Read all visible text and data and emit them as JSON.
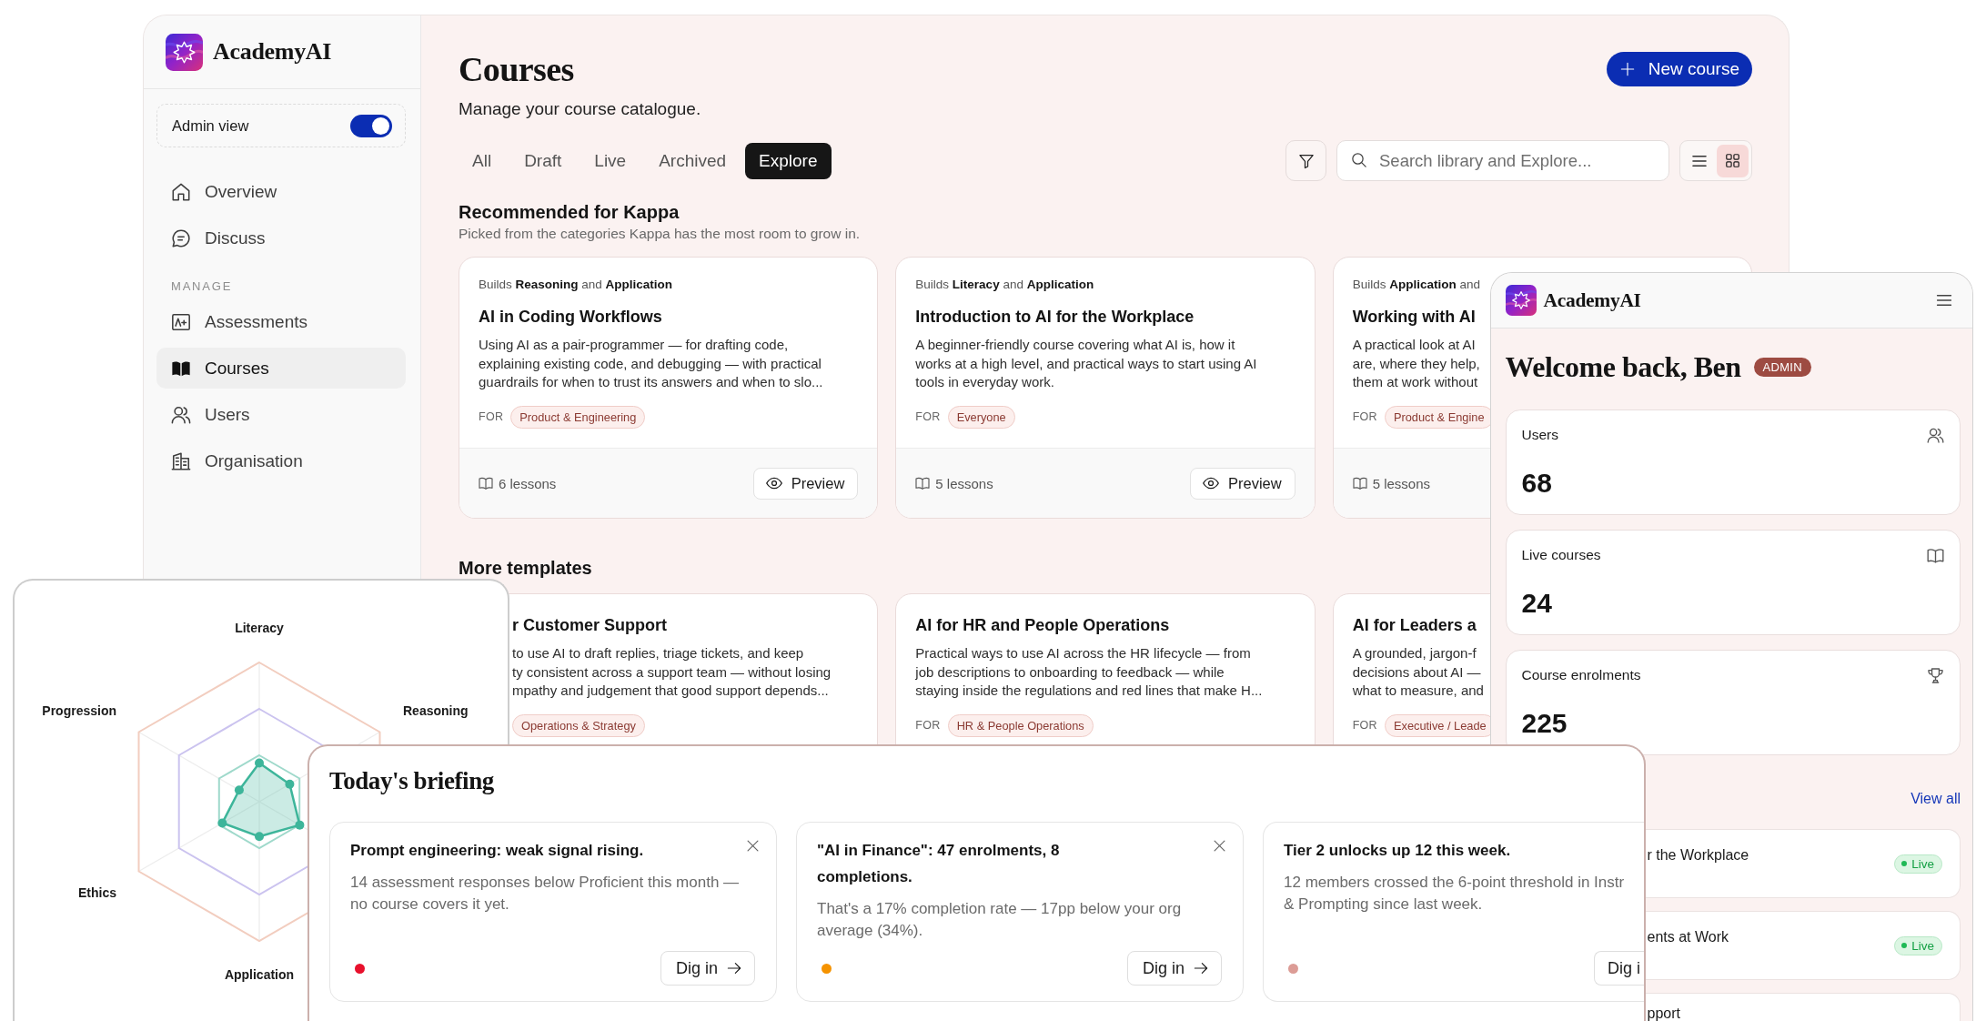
{
  "courses_window": {
    "sidebar": {
      "brand": "AcademyAI",
      "admin_view": {
        "label": "Admin view",
        "on": true
      },
      "nav": [
        {
          "label": "Overview",
          "selected": false
        },
        {
          "label": "Discuss",
          "selected": false
        }
      ],
      "manage_section": {
        "heading": "MANAGE",
        "items": [
          {
            "label": "Assessments",
            "selected": false
          },
          {
            "label": "Courses",
            "selected": true
          },
          {
            "label": "Users",
            "selected": false
          },
          {
            "label": "Organisation",
            "selected": false
          }
        ]
      }
    },
    "header": {
      "title": "Courses",
      "subtitle": "Manage your course catalogue.",
      "new_button": "New course"
    },
    "tabs": [
      {
        "label": "All",
        "selected": false
      },
      {
        "label": "Draft",
        "selected": false
      },
      {
        "label": "Live",
        "selected": false
      },
      {
        "label": "Archived",
        "selected": false
      },
      {
        "label": "Explore",
        "selected": true
      }
    ],
    "search": {
      "placeholder": "Search library and Explore..."
    },
    "view_modes": [
      {
        "kind": "list",
        "selected": false
      },
      {
        "kind": "grid",
        "selected": true
      }
    ],
    "sections": [
      {
        "title": "Recommended for Kappa",
        "subtitle": "Picked from the categories Kappa has the most room to grow in.",
        "cards": [
          {
            "builds": "Builds **Reasoning** and **Application**",
            "title": "AI in Coding Workflows",
            "description": "Using AI as a pair-programmer — for drafting code,\nexplaining existing code, and debugging — with practical\nguardrails for when to trust its answers and when to slo...",
            "for_label": "FOR",
            "audience": "Product & Engineering",
            "lessons": "6 lessons",
            "action": "Preview"
          },
          {
            "builds": "Builds **Literacy** and **Application**",
            "title": "Introduction to AI for the Workplace",
            "description": "A beginner-friendly course covering what AI is, how it\nworks at a high level, and practical ways to start using AI\ntools in everyday work.",
            "for_label": "FOR",
            "audience": "Everyone",
            "lessons": "5 lessons",
            "action": "Preview"
          },
          {
            "builds": "Builds **Application** and",
            "title": "Working with AI",
            "description": "A practical look at AI\nare, where they help,\nthem at work without",
            "for_label": "FOR",
            "audience": "Product & Engine",
            "lessons": "5 lessons"
          }
        ]
      },
      {
        "title": "More templates",
        "cards": [
          {
            "title": "r Customer Support",
            "description": "to use AI to draft replies, triage tickets, and keep\nty consistent across a support team — without losing\nmpathy and judgement that good support depends...",
            "audience": "Operations & Strategy"
          },
          {
            "title": "AI for HR and People Operations",
            "description": "Practical ways to use AI across the HR lifecycle — from\njob descriptions to onboarding to feedback — while\nstaying inside the regulations and red lines that make H...",
            "for_label": "FOR",
            "audience": "HR & People Operations"
          },
          {
            "title": "AI for Leaders a",
            "description": "A grounded, jargon-f\ndecisions about AI —\nwhat to measure, and",
            "for_label": "FOR",
            "audience": "Executive / Leade"
          }
        ]
      }
    ]
  },
  "mobile_window": {
    "brand": "AcademyAI",
    "greeting": "Welcome back, Ben",
    "role_badge": "ADMIN",
    "stats": [
      {
        "label": "Users",
        "value": "68"
      },
      {
        "label": "Live courses",
        "value": "24"
      },
      {
        "label": "Course enrolments",
        "value": "225"
      }
    ],
    "view_all": "View all",
    "courses": [
      {
        "title": "r the Workplace",
        "status": "Live"
      },
      {
        "title": "ents at Work",
        "status": "Live"
      },
      {
        "title": "pport"
      }
    ]
  },
  "skills_chart": {
    "axis_labels": [
      "Literacy",
      "Reasoning",
      "Application",
      "Ethics",
      "Progression"
    ]
  },
  "briefing": {
    "title": "Today's briefing",
    "cards": [
      {
        "title": "Prompt engineering: weak signal rising.",
        "text": "14 assessment responses below Proficient this month —\nno course covers it yet.",
        "color": "#e8102c",
        "dismissible": true,
        "action": "Dig in"
      },
      {
        "title": "\"AI in Finance\": 47 enrolments, 8 completions.",
        "text": "That's a 17% completion rate — 17pp below your org\naverage (34%).",
        "color": "#f59300",
        "dismissible": true,
        "action": "Dig in"
      },
      {
        "title": "Tier 2 unlocks up 12 this week.",
        "text": "12 members crossed the 6-point threshold in Instr\n& Prompting since last week.",
        "color": "#dc9c96",
        "dismissible": false,
        "action": "Dig i"
      }
    ]
  }
}
